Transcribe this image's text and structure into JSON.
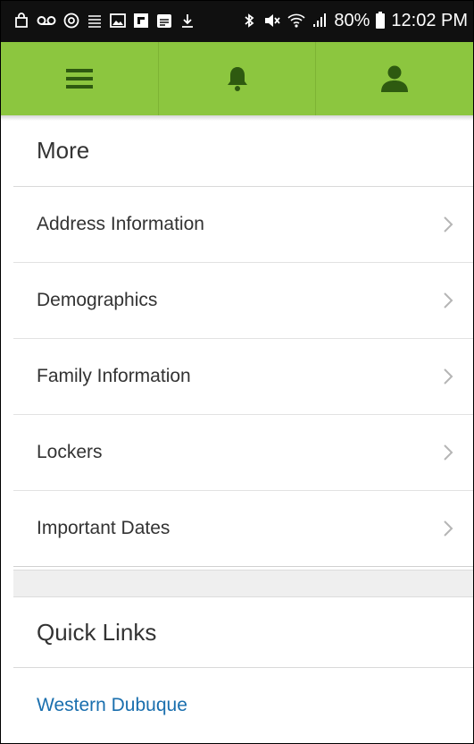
{
  "status_bar": {
    "battery": "80%",
    "time": "12:02 PM"
  },
  "toolbar": {
    "items": [
      {
        "icon": "menu-icon"
      },
      {
        "icon": "bell-icon"
      },
      {
        "icon": "user-icon"
      }
    ],
    "accent": "#8cc63f"
  },
  "more": {
    "title": "More",
    "items": [
      {
        "label": "Address Information"
      },
      {
        "label": "Demographics"
      },
      {
        "label": "Family Information"
      },
      {
        "label": "Lockers"
      },
      {
        "label": "Important Dates"
      }
    ]
  },
  "quick_links": {
    "title": "Quick Links",
    "items": [
      {
        "label": "Western Dubuque",
        "color": "#1a6fae"
      }
    ]
  }
}
